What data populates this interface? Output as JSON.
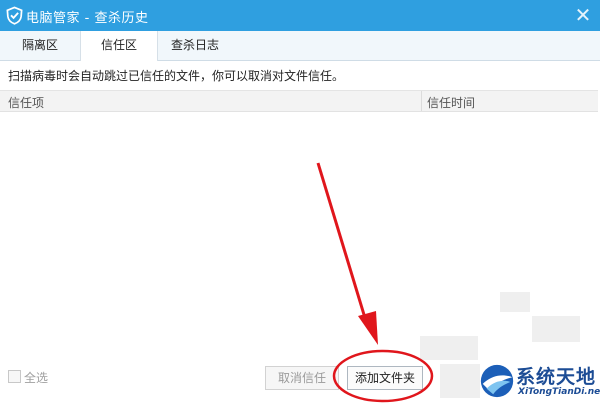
{
  "window": {
    "title": "电脑管家 - 查杀历史",
    "close_symbol": "✕"
  },
  "tabs": [
    {
      "label": "隔离区",
      "active": false
    },
    {
      "label": "信任区",
      "active": true
    },
    {
      "label": "查杀日志",
      "active": false
    }
  ],
  "notice": "扫描病毒时会自动跳过已信任的文件，你可以取消对文件信任。",
  "table": {
    "columns": [
      "信任项",
      "信任时间"
    ],
    "rows": []
  },
  "footer": {
    "select_all_label": "全选",
    "select_all_checked": false,
    "untrust_button": "取消信任",
    "untrust_enabled": false,
    "add_folder_button": "添加文件夹"
  },
  "watermark": {
    "name": "系统天地",
    "site": "XiTongTianDi.net"
  },
  "colors": {
    "titlebar": "#2f9fe0",
    "annotation": "#e0161c",
    "watermark": "#1c4c95"
  },
  "icons": {
    "title_icon": "shield-check-icon",
    "close_icon": "close-icon"
  }
}
